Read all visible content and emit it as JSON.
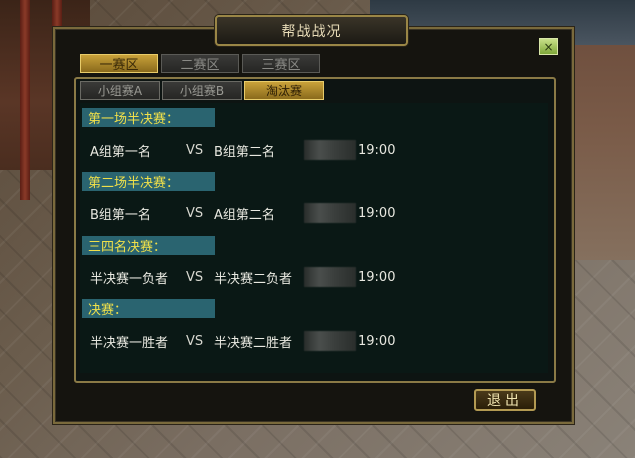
{
  "window": {
    "title": "帮战战况",
    "close_icon": "×"
  },
  "zone_tabs": [
    {
      "label": "一赛区",
      "active": true
    },
    {
      "label": "二赛区",
      "active": false
    },
    {
      "label": "三赛区",
      "active": false
    }
  ],
  "sub_tabs": [
    {
      "label": "小组赛A",
      "active": false
    },
    {
      "label": "小组赛B",
      "active": false
    },
    {
      "label": "淘汰赛",
      "active": true
    }
  ],
  "matches": [
    {
      "header": "第一场半决赛：",
      "team_a": "A组第一名",
      "vs": "VS",
      "team_b": "B组第二名",
      "time": "19:00"
    },
    {
      "header": "第二场半决赛：",
      "team_a": "B组第一名",
      "vs": "VS",
      "team_b": "A组第二名",
      "time": "19:00"
    },
    {
      "header": "三四名决赛：",
      "team_a": "半决赛一负者",
      "vs": "VS",
      "team_b": "半决赛二负者",
      "time": "19:00"
    },
    {
      "header": "决赛：",
      "team_a": "半决赛一胜者",
      "vs": "VS",
      "team_b": "半决赛二胜者",
      "time": "19:00"
    }
  ],
  "footer": {
    "exit_label": "退出"
  },
  "colors": {
    "accent_gold": "#c9a23a",
    "header_bg": "#2a6470",
    "header_text": "#f0e04a"
  }
}
